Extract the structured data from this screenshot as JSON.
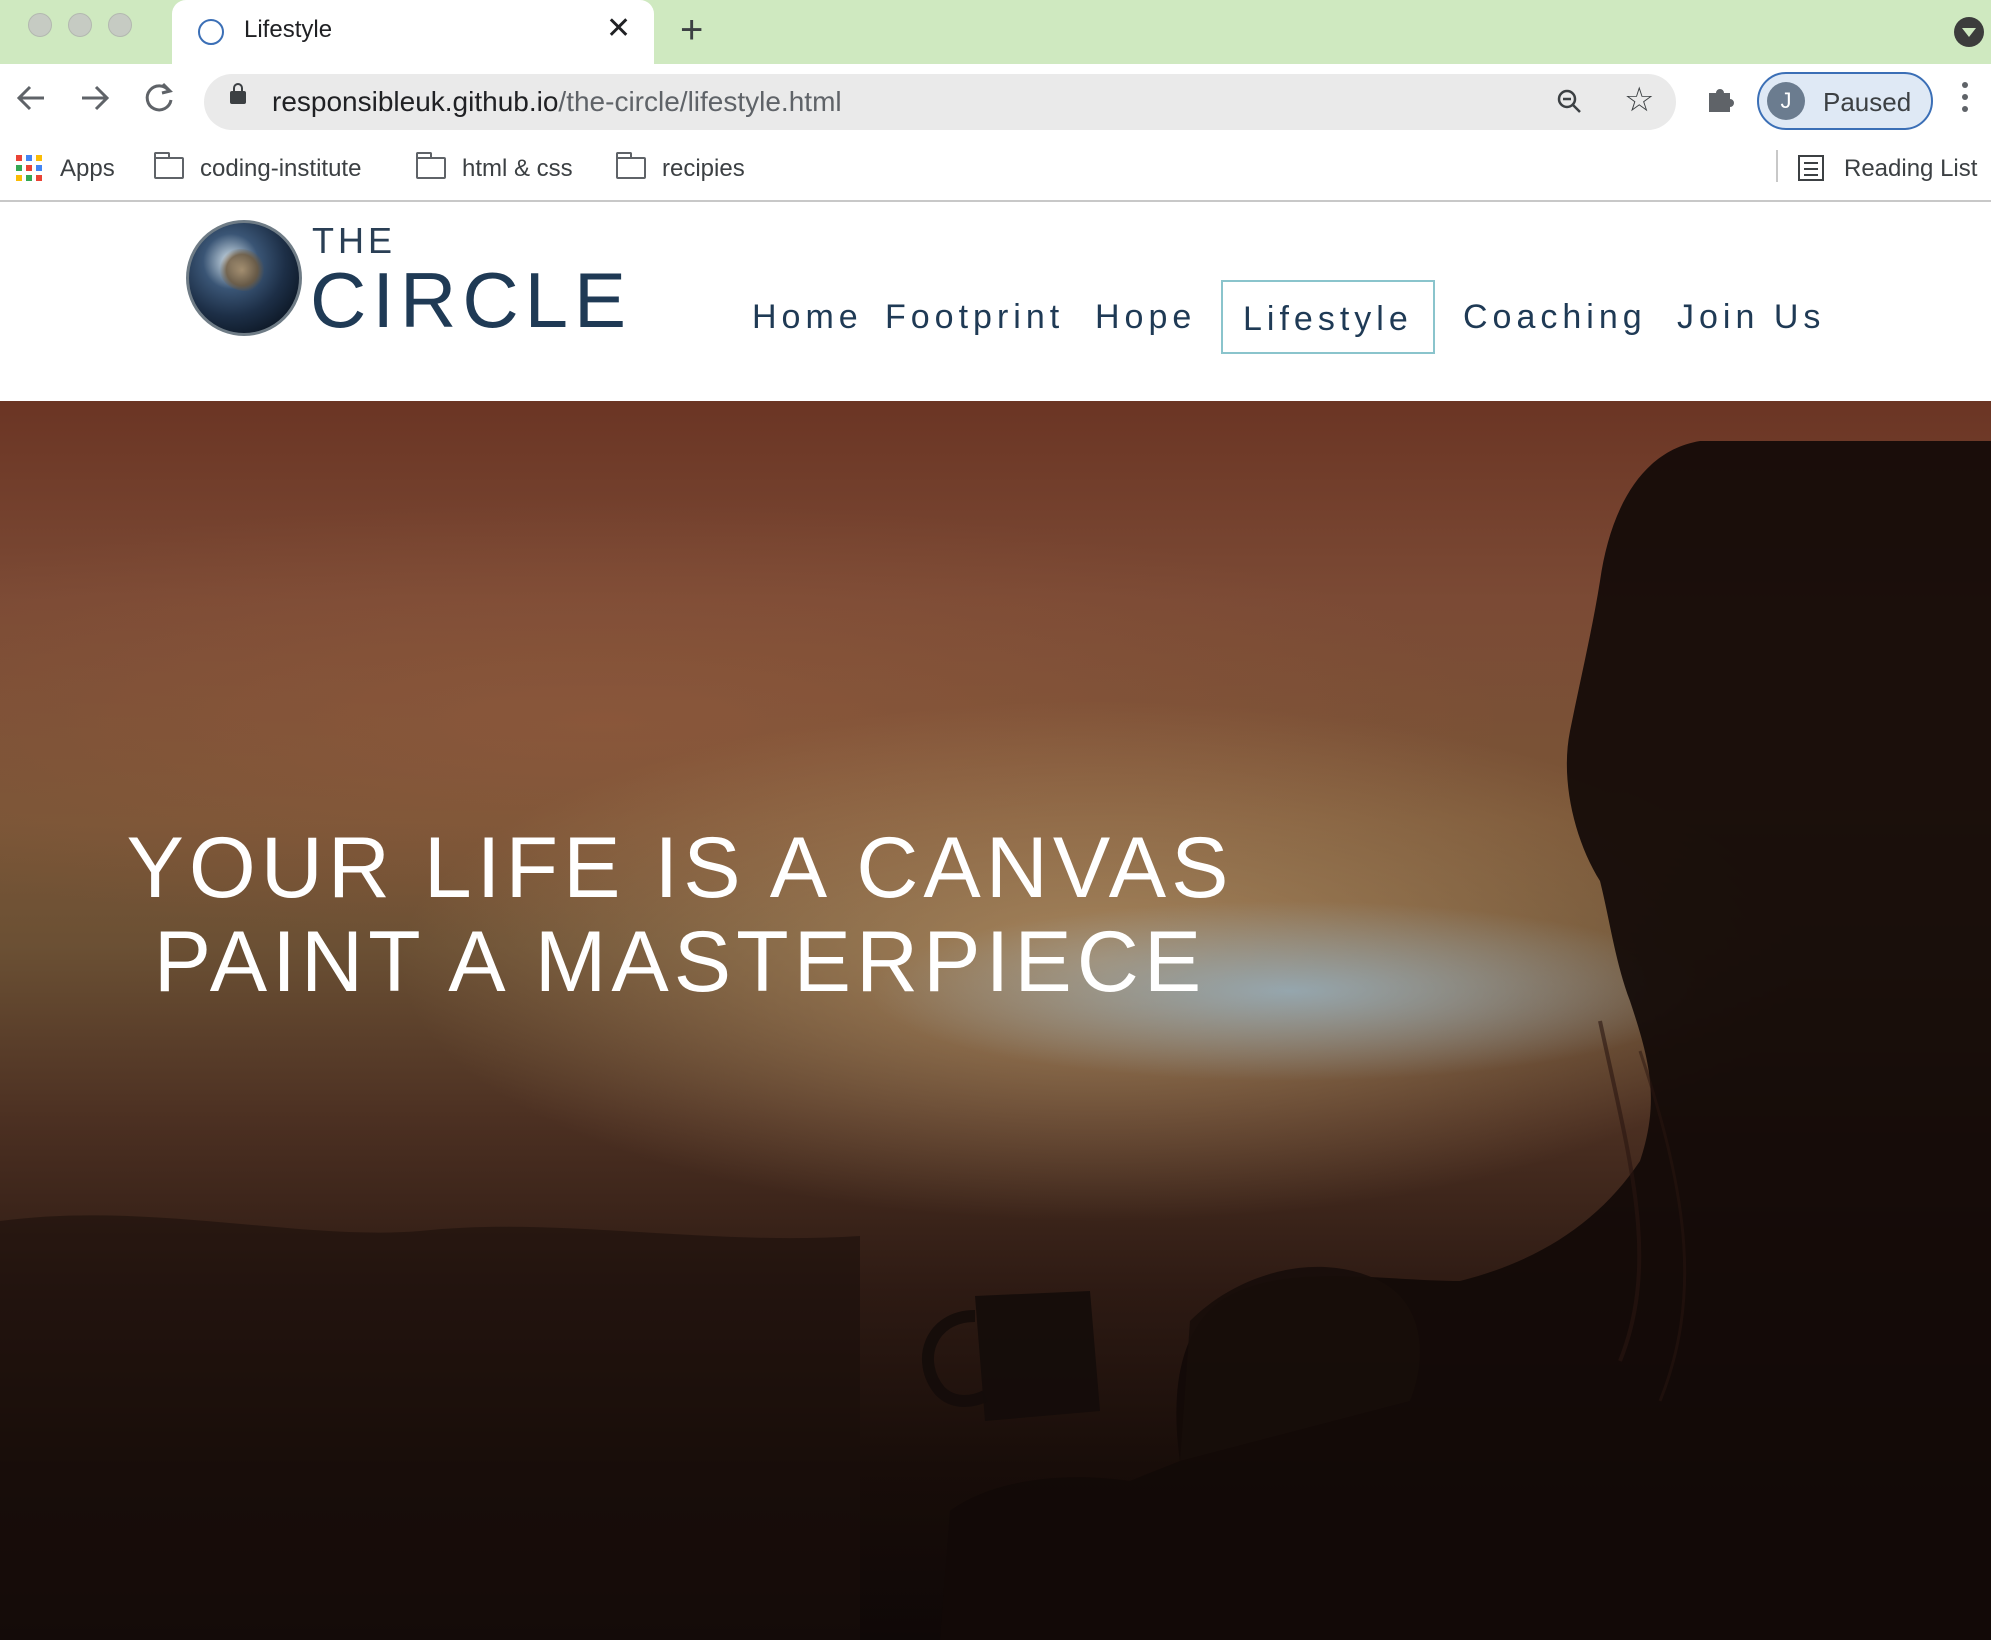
{
  "browser": {
    "tab_title": "Lifestyle",
    "url_host": "responsibleuk.github.io",
    "url_path": "/the-circle/lifestyle.html",
    "profile_initial": "J",
    "profile_status": "Paused",
    "bookmarks": [
      {
        "label": "Apps",
        "icon": "apps-grid-icon"
      },
      {
        "label": "coding-institute",
        "icon": "folder-icon"
      },
      {
        "label": "html & css",
        "icon": "folder-icon"
      },
      {
        "label": "recipies",
        "icon": "folder-icon"
      }
    ],
    "reading_list_label": "Reading List",
    "tabstrip_color": "#cfe9c0",
    "profile_ring_color": "#3b6fb6"
  },
  "site": {
    "logo": {
      "top": "THE",
      "main": "CIRCLE"
    },
    "nav": [
      {
        "label": "Home"
      },
      {
        "label": "Footprint"
      },
      {
        "label": "Hope"
      },
      {
        "label": "Lifestyle",
        "active": true
      },
      {
        "label": "Coaching"
      },
      {
        "label": "Join Us"
      }
    ],
    "nav_color": "#1f3a55",
    "active_border_color": "#8ac4cc"
  },
  "hero": {
    "line1": "YOUR LIFE IS A CANVAS",
    "line2": "PAINT A MASTERPIECE"
  }
}
